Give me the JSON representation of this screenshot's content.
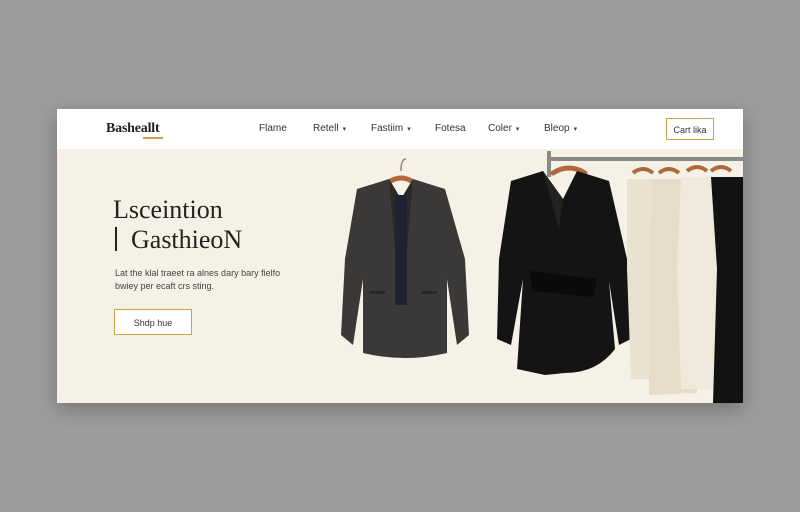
{
  "brand": {
    "name": "Basheallt"
  },
  "nav": {
    "items": [
      {
        "label": "Flame",
        "has_dropdown": false
      },
      {
        "label": "Retell",
        "has_dropdown": true
      },
      {
        "label": "Fastiim",
        "has_dropdown": true
      },
      {
        "label": "Fotesa",
        "has_dropdown": false
      },
      {
        "label": "Coler",
        "has_dropdown": true
      },
      {
        "label": "Bleop",
        "has_dropdown": true
      }
    ],
    "cta_label": "Cart lika"
  },
  "hero": {
    "title_line1": "Lsceintion",
    "title_line2": "GasthieoN",
    "description": "Lat the klal traeet ra alnes dary bary fielfo bwiey per ecaft crs sting.",
    "button_label": "Shdp hue"
  },
  "colors": {
    "accent": "#c9a24a",
    "hero_bg": "#f6f1e7",
    "page_bg": "#9c9c9c"
  },
  "icons": {
    "dropdown": "chevron-down-icon"
  }
}
